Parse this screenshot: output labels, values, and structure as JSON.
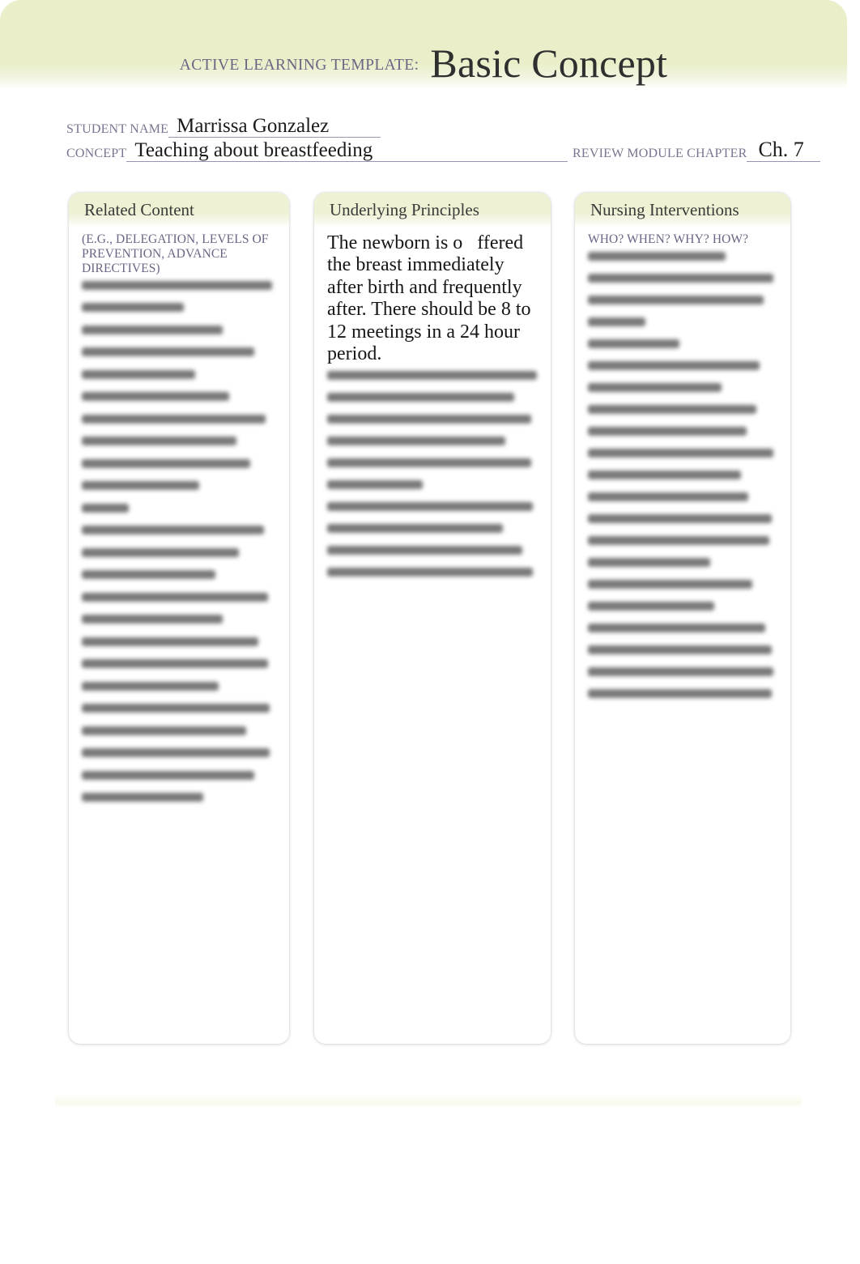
{
  "banner": {
    "template_label": "ACTIVE LEARNING TEMPLATE:",
    "title": "Basic Concept",
    "background_color": "#eaefca"
  },
  "meta": {
    "student_name_label": "STUDENT NAME",
    "student_name_value": "Marrissa Gonzalez",
    "concept_label": "CONCEPT",
    "concept_value": "Teaching about breastfeeding",
    "review_module_chapter_label": "REVIEW MODULE CHAPTER",
    "review_module_chapter_value": "Ch. 7"
  },
  "columns": [
    {
      "title": "Related Content",
      "subtitle": "(E.G., DELEGATION,\nLEVELS OF PREVENTION,\nADVANCE DIRECTIVES)",
      "body_text": "",
      "body_redacted": true,
      "redacted_line_widths": [
        "97%",
        "52%",
        "4%",
        "72%",
        "4%",
        "88%",
        "4%",
        "58%",
        "4%",
        "75%",
        "4%",
        "4%",
        "94%",
        "79%",
        "4%",
        "86%",
        "60%",
        "4%",
        "24%",
        "4%",
        "93%",
        "80%",
        "4%",
        "68%",
        "4%",
        "95%",
        "72%",
        "4%",
        "90%",
        "4%",
        "95%",
        "70%",
        "4%",
        "96%",
        "84%",
        "96%",
        "88%",
        "62%"
      ]
    },
    {
      "title": "Underlying Principles",
      "subtitle": "",
      "body_text": "The newborn is o   ffered the breast immediately after birth and frequently after. There should be 8 to 12 meetings in a 24 hour period.",
      "body_redacted": true,
      "redacted_line_widths": [
        "99%",
        "4%",
        "88%",
        "4%",
        "96%",
        "4%",
        "84%",
        "4%",
        "96%",
        "4%",
        "45%",
        "4%",
        "97%",
        "4%",
        "83%",
        "4%",
        "92%",
        "4%",
        "97%"
      ]
    },
    {
      "title": "Nursing Interventions",
      "subtitle": "WHO? WHEN? WHY? HOW?",
      "body_text": "",
      "body_redacted": true,
      "redacted_line_widths": [
        "72%",
        "4%",
        "97%",
        "4%",
        "92%",
        "4%",
        "30%",
        "4%",
        "48%",
        "4%",
        "90%",
        "4%",
        "70%",
        "4%",
        "88%",
        "4%",
        "83%",
        "4%",
        "97%",
        "4%",
        "80%",
        "4%",
        "4%",
        "84%",
        "4%",
        "96%",
        "4%",
        "95%",
        "4%",
        "64%",
        "4%",
        "86%",
        "4%",
        "66%",
        "4%",
        "93%",
        "4%",
        "96%",
        "4%",
        "97%",
        "4%",
        "96%"
      ]
    }
  ],
  "colors": {
    "banner": "#eaefca",
    "card_header": "#eef1d4",
    "label_purple": "#6d6484",
    "rule_purple": "#9b93b2",
    "text_dark": "#1b1b1b"
  }
}
